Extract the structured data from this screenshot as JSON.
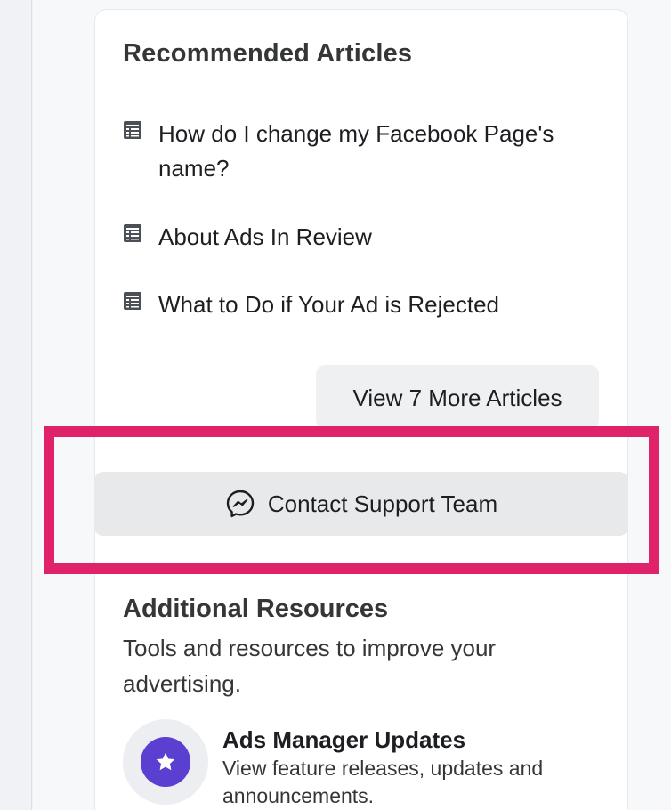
{
  "recommended": {
    "title": "Recommended Articles",
    "articles": [
      {
        "label": "How do I change my Facebook Page's name?",
        "icon": "document-icon"
      },
      {
        "label": "About Ads In Review",
        "icon": "document-icon"
      },
      {
        "label": "What to Do if Your Ad is Rejected",
        "icon": "document-icon"
      }
    ],
    "more_button": "View 7 More Articles"
  },
  "contact": {
    "label": "Contact Support Team",
    "icon": "messenger-icon"
  },
  "highlight_color": "#e0226a",
  "additional": {
    "title": "Additional Resources",
    "subtitle": "Tools and resources to improve your advertising.",
    "items": [
      {
        "title": "Ads Manager Updates",
        "description": "View feature releases, updates and announcements.",
        "icon": "star-icon",
        "icon_color": "#5b3fd0"
      }
    ]
  }
}
